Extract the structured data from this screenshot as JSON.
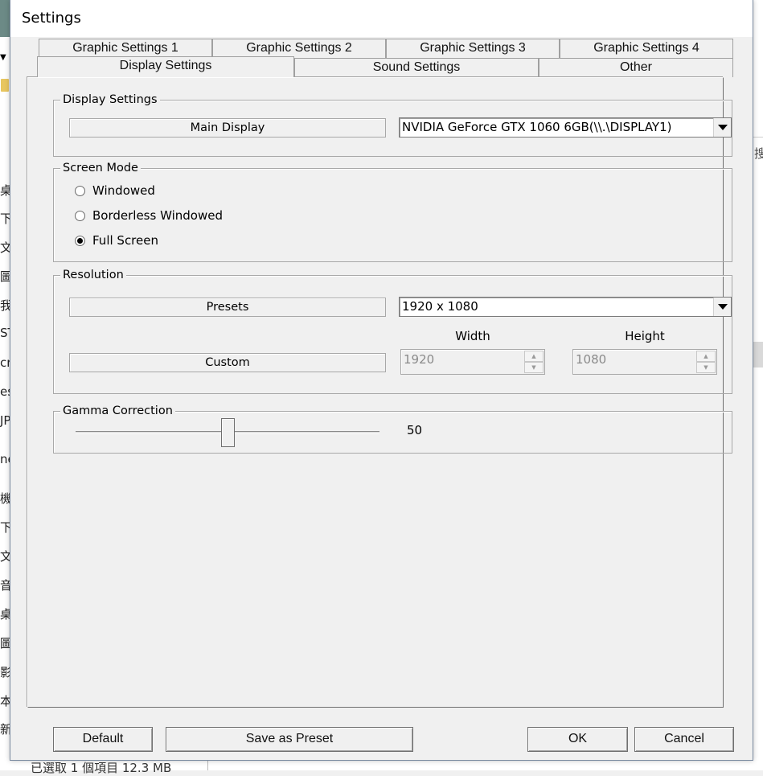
{
  "window": {
    "title": "Settings"
  },
  "tabs": {
    "row1": [
      "Graphic Settings 1",
      "Graphic Settings 2",
      "Graphic Settings 3",
      "Graphic Settings 4"
    ],
    "row2": [
      "Display Settings",
      "Sound Settings",
      "Other"
    ],
    "active": "Display Settings"
  },
  "display_settings": {
    "group_title": "Display Settings",
    "main_display_label": "Main Display",
    "main_display_value": "NVIDIA GeForce GTX 1060 6GB(\\\\.\\DISPLAY1)"
  },
  "screen_mode": {
    "group_title": "Screen Mode",
    "options": [
      "Windowed",
      "Borderless Windowed",
      "Full Screen"
    ],
    "selected": "Full Screen"
  },
  "resolution": {
    "group_title": "Resolution",
    "presets_label": "Presets",
    "presets_value": "1920 x 1080",
    "width_header": "Width",
    "height_header": "Height",
    "custom_label": "Custom",
    "custom_width": "1920",
    "custom_height": "1080"
  },
  "gamma": {
    "group_title": "Gamma Correction",
    "value": "50",
    "level": 50
  },
  "buttons": {
    "default": "Default",
    "save_preset": "Save as Preset",
    "ok": "OK",
    "cancel": "Cancel"
  },
  "background": {
    "sidebar_chars": [
      "桌",
      "下",
      "文",
      "圖",
      "我",
      "ST",
      "cr",
      "es",
      "JP",
      "ne",
      "機",
      "下",
      "文",
      "音",
      "桌",
      "圖",
      "影",
      "本",
      "新"
    ],
    "right_char": "搜",
    "status_text": "已選取 1 個項目 12.3 MB"
  }
}
